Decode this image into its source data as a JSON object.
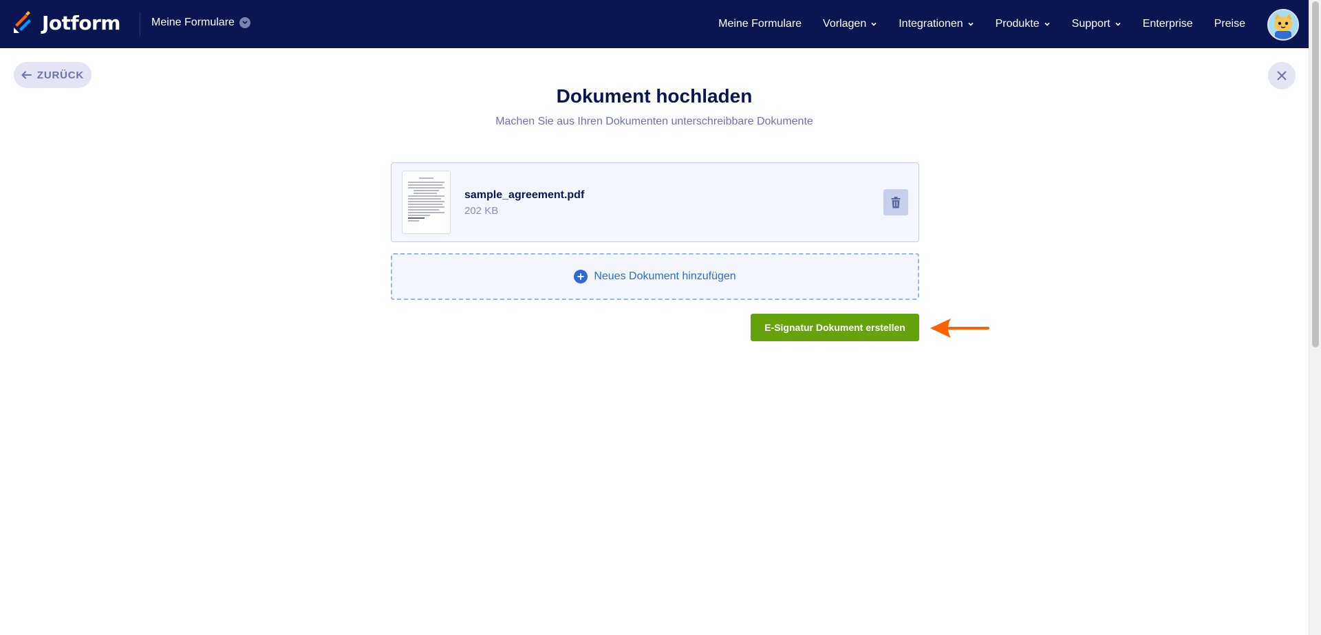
{
  "navbar": {
    "brand": "Jotform",
    "my_forms": "Meine Formulare",
    "links": [
      {
        "label": "Meine Formulare",
        "dropdown": false
      },
      {
        "label": "Vorlagen",
        "dropdown": true
      },
      {
        "label": "Integrationen",
        "dropdown": true
      },
      {
        "label": "Produkte",
        "dropdown": true
      },
      {
        "label": "Support",
        "dropdown": true
      },
      {
        "label": "Enterprise",
        "dropdown": false
      },
      {
        "label": "Preise",
        "dropdown": false
      }
    ]
  },
  "back_label": "ZURÜCK",
  "title": "Dokument hochladen",
  "subtitle": "Machen Sie aus Ihren Dokumenten unterschreibbare Dokumente",
  "file": {
    "name": "sample_agreement.pdf",
    "size": "202 KB"
  },
  "add_document_label": "Neues Dokument hinzufügen",
  "create_button_label": "E-Signatur Dokument erstellen",
  "colors": {
    "navbar": "#0a1551",
    "accent_blue": "#2e69d6",
    "create_green": "#64a30c",
    "annotation_arrow": "#ff6100"
  },
  "icons": {
    "back": "arrow-left-icon",
    "close": "close-icon",
    "delete": "trash-icon",
    "add": "plus-circle-icon",
    "annotation": "arrow-left-annotation"
  }
}
